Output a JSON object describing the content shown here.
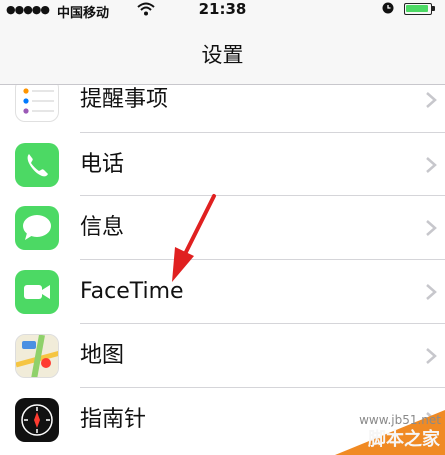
{
  "status_bar": {
    "signal_dots": "●●●●●",
    "carrier": "中国移动",
    "time": "21:38"
  },
  "nav": {
    "title": "设置"
  },
  "rows": [
    {
      "label": "提醒事项",
      "icon": "reminders-icon"
    },
    {
      "label": "电话",
      "icon": "phone-icon"
    },
    {
      "label": "信息",
      "icon": "messages-icon"
    },
    {
      "label": "FaceTime",
      "icon": "facetime-icon"
    },
    {
      "label": "地图",
      "icon": "maps-icon"
    },
    {
      "label": "指南针",
      "icon": "compass-icon"
    }
  ],
  "colors": {
    "green": "#4cd964",
    "arrow": "#e02020"
  },
  "watermark": {
    "url": "www.jb51.net",
    "text": "脚本之家"
  }
}
